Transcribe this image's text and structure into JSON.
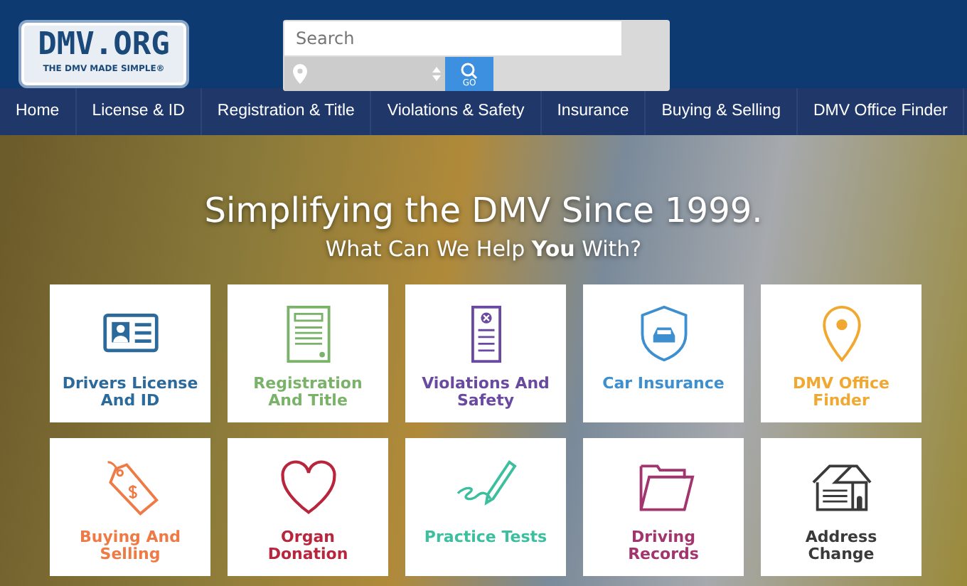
{
  "logo": {
    "title": "DMV.ORG",
    "tagline": "THE DMV MADE SIMPLE®"
  },
  "search": {
    "placeholder": "Search",
    "go_label": "GO"
  },
  "nav": [
    {
      "label": "Home"
    },
    {
      "label": "License & ID"
    },
    {
      "label": "Registration & Title"
    },
    {
      "label": "Violations & Safety"
    },
    {
      "label": "Insurance"
    },
    {
      "label": "Buying & Selling"
    },
    {
      "label": "DMV Office Finder"
    }
  ],
  "hero": {
    "title": "Simplifying the DMV Since 1999.",
    "subtitle": "What Can We Help **You** With?"
  },
  "tiles": [
    {
      "label": "Drivers License And ID",
      "color": "#2b6a9a"
    },
    {
      "label": "Registration And Title",
      "color": "#7bb26a"
    },
    {
      "label": "Violations And Safety",
      "color": "#6a4aa0"
    },
    {
      "label": "Car Insurance",
      "color": "#3d8fcf"
    },
    {
      "label": "DMV Office Finder",
      "color": "#f0a830"
    },
    {
      "label": "Buying And Selling",
      "color": "#ee7a45"
    },
    {
      "label": "Organ Donation",
      "color": "#b8253c"
    },
    {
      "label": "Practice Tests",
      "color": "#3bbf9e"
    },
    {
      "label": "Driving Records",
      "color": "#a3356e"
    },
    {
      "label": "Address Change",
      "color": "#3a3a3a"
    }
  ]
}
